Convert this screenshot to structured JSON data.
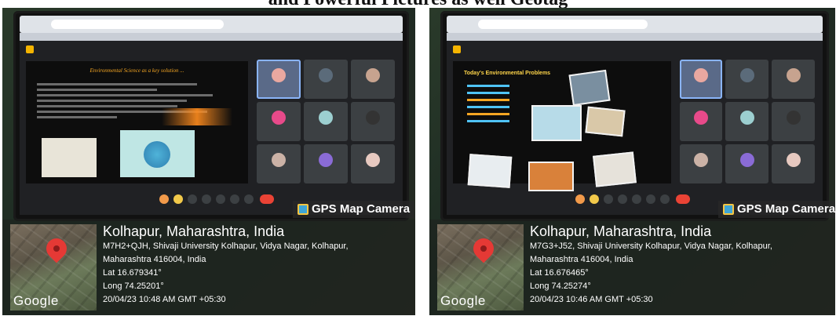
{
  "caption": {
    "text": "and Powerful Pictures as well Geotag"
  },
  "panels": [
    {
      "gps_label": "GPS Map Camera",
      "google_label": "Google",
      "location": "Kolhapur, Maharashtra, India",
      "address_line1": "M7H2+QJH, Shivaji University Kolhapur, Vidya Nagar, Kolhapur,",
      "address_line2": "Maharashtra 416004, India",
      "lat": "Lat 16.679341°",
      "long": "Long 74.25201°",
      "datetime": "20/04/23 10:48 AM GMT +05:30",
      "slide_title": "Environmental Science as a key solution ..."
    },
    {
      "gps_label": "GPS Map Camera",
      "google_label": "Google",
      "location": "Kolhapur, Maharashtra, India",
      "address_line1": "M7G3+J52, Shivaji University Kolhapur, Vidya Nagar, Kolhapur,",
      "address_line2": "Maharashtra 416004, India",
      "lat": "Lat 16.676465°",
      "long": "Long 74.25274°",
      "datetime": "20/04/23 10:46 AM GMT +05:30",
      "slide_title": "Today's Environmental Problems"
    }
  ],
  "colors": {
    "pin": "#e53935",
    "gps_icon": "#3fa6d6",
    "slide_title_left": "#f5a623",
    "slide_title_right": "#ffd54a"
  },
  "icons": {
    "map_pin": "map-pin-icon",
    "gps_camera": "gps-camera-icon"
  }
}
